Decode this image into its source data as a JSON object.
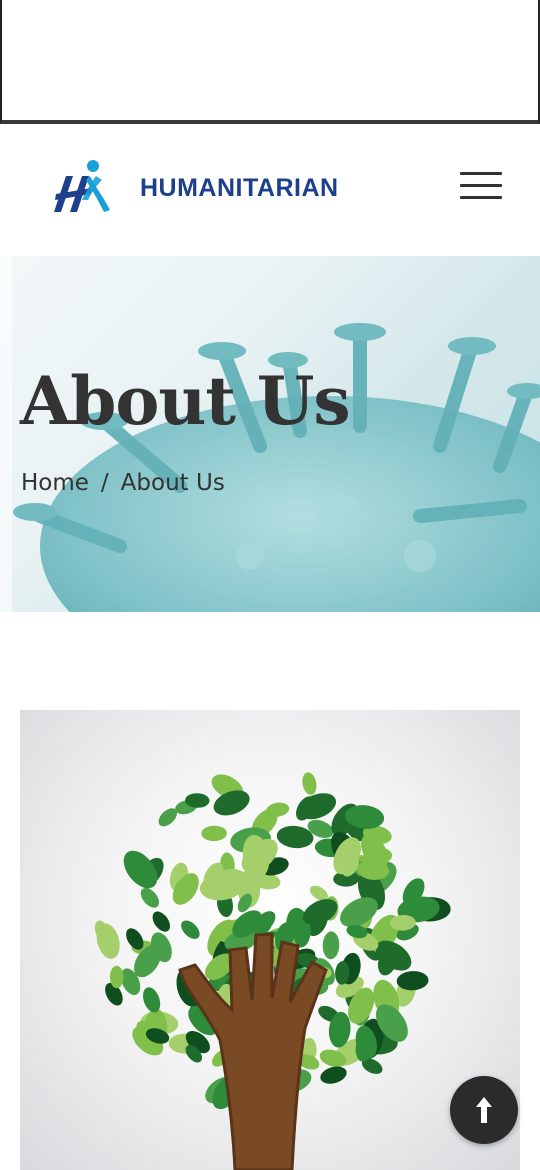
{
  "header": {
    "brand_name": "HUMANITARIAN",
    "logo_icon": "humanitarian-logo-icon",
    "menu_icon": "hamburger-menu-icon"
  },
  "hero": {
    "title": "About Us",
    "breadcrumb": {
      "home": "Home",
      "separator": "/",
      "current": "About Us"
    }
  },
  "colors": {
    "brand_blue": "#1e3f8c",
    "logo_cyan": "#1aa0d8",
    "virus_teal": "#5aaeb5",
    "title_dark": "#333333",
    "scroll_button": "#2b2b2b"
  },
  "scroll_top_icon": "arrow-up-icon"
}
